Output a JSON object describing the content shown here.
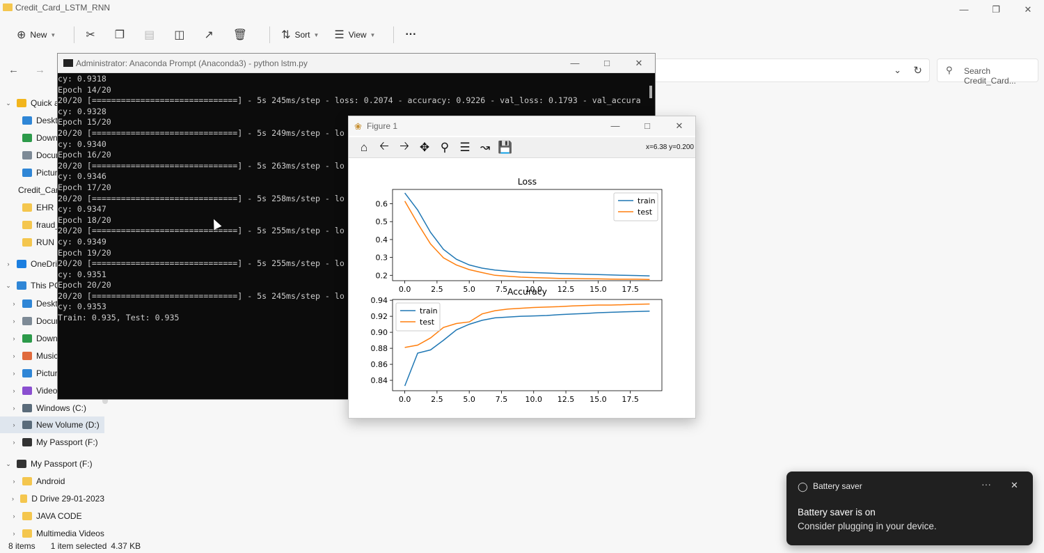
{
  "explorer": {
    "window_title": "Credit_Card_LSTM_RNN",
    "toolbar": {
      "new_label": "New",
      "sort_label": "Sort",
      "view_label": "View",
      "more_label": "···"
    },
    "search_placeholder": "Search Credit_Card...",
    "sidebar": [
      {
        "label": "Quick access",
        "level": 0,
        "icon": "star-icon",
        "color": "#f2b51d"
      },
      {
        "label": "Desktop",
        "level": 1,
        "icon": "desktop-icon",
        "color": "#2f86d6"
      },
      {
        "label": "Downloads",
        "level": 1,
        "icon": "download-icon",
        "color": "#2c9a4a"
      },
      {
        "label": "Documents",
        "level": 1,
        "icon": "document-icon",
        "color": "#7d8a96"
      },
      {
        "label": "Pictures",
        "level": 1,
        "icon": "pictures-icon",
        "color": "#2f86d6"
      },
      {
        "label": "Credit_Card_LSTM_RNN",
        "level": 1,
        "icon": "folder-icon",
        "color": "#f4c64e"
      },
      {
        "label": "EHR",
        "level": 1,
        "icon": "folder-icon",
        "color": "#f4c64e"
      },
      {
        "label": "fraud_detection",
        "level": 1,
        "icon": "folder-icon",
        "color": "#f4c64e"
      },
      {
        "label": "RUN",
        "level": 1,
        "icon": "folder-icon",
        "color": "#f4c64e"
      },
      {
        "label": "OneDrive",
        "level": 0,
        "icon": "cloud-icon",
        "color": "#1c7fe0"
      },
      {
        "label": "This PC",
        "level": 0,
        "icon": "computer-icon",
        "color": "#2f86d6"
      },
      {
        "label": "Desktop",
        "level": 1,
        "icon": "desktop-icon",
        "color": "#2f86d6"
      },
      {
        "label": "Documents",
        "level": 1,
        "icon": "document-icon",
        "color": "#7d8a96"
      },
      {
        "label": "Downloads",
        "level": 1,
        "icon": "download-icon",
        "color": "#2c9a4a"
      },
      {
        "label": "Music",
        "level": 1,
        "icon": "music-icon",
        "color": "#e06a3c"
      },
      {
        "label": "Pictures",
        "level": 1,
        "icon": "pictures-icon",
        "color": "#2f86d6"
      },
      {
        "label": "Videos",
        "level": 1,
        "icon": "videos-icon",
        "color": "#8a4fd0"
      },
      {
        "label": "Windows (C:)",
        "level": 1,
        "icon": "drive-icon",
        "color": "#5a6b7a"
      },
      {
        "label": "New Volume (D:)",
        "level": 1,
        "icon": "drive-icon",
        "color": "#5a6b7a"
      },
      {
        "label": "My Passport (F:)",
        "level": 1,
        "icon": "drive-icon",
        "color": "#333333"
      },
      {
        "label": "My Passport (F:)",
        "level": 0,
        "icon": "drive-icon",
        "color": "#333333"
      },
      {
        "label": "Android",
        "level": 1,
        "icon": "folder-icon",
        "color": "#f4c64e"
      },
      {
        "label": "D Drive 29-01-2023",
        "level": 1,
        "icon": "folder-icon",
        "color": "#f4c64e"
      },
      {
        "label": "JAVA CODE",
        "level": 1,
        "icon": "folder-icon",
        "color": "#f4c64e"
      },
      {
        "label": "Multimedia Videos",
        "level": 1,
        "icon": "folder-icon",
        "color": "#f4c64e"
      }
    ],
    "status": {
      "items": "8 items",
      "selected": "1 item selected",
      "size": "4.37 KB"
    }
  },
  "terminal": {
    "title": "Administrator: Anaconda Prompt (Anaconda3) - python  lstm.py",
    "lines": [
      "cy: 0.9318",
      "Epoch 14/20",
      "20/20 [==============================] - 5s 245ms/step - loss: 0.2074 - accuracy: 0.9226 - val_loss: 0.1793 - val_accura",
      "cy: 0.9328",
      "Epoch 15/20",
      "20/20 [==============================] - 5s 249ms/step - lo",
      "cy: 0.9340",
      "Epoch 16/20",
      "20/20 [==============================] - 5s 263ms/step - lo",
      "cy: 0.9346",
      "Epoch 17/20",
      "20/20 [==============================] - 5s 258ms/step - lo",
      "cy: 0.9347",
      "Epoch 18/20",
      "20/20 [==============================] - 5s 255ms/step - lo",
      "cy: 0.9349",
      "Epoch 19/20",
      "20/20 [==============================] - 5s 255ms/step - lo",
      "cy: 0.9351",
      "Epoch 20/20",
      "20/20 [==============================] - 5s 245ms/step - lo",
      "cy: 0.9353",
      "Train: 0.935, Test: 0.935"
    ]
  },
  "figure": {
    "title": "Figure 1",
    "coords": "x=6.38 y=0.200"
  },
  "chart_data": [
    {
      "type": "line",
      "title": "Loss",
      "xlabel": "",
      "ylabel": "",
      "x": [
        0,
        1,
        2,
        3,
        4,
        5,
        6,
        7,
        8,
        9,
        10,
        11,
        12,
        13,
        14,
        15,
        16,
        17,
        18,
        19
      ],
      "xlim": [
        -0.95,
        19.95
      ],
      "ylim": [
        0.17,
        0.68
      ],
      "xticks": [
        0.0,
        2.5,
        5.0,
        7.5,
        10.0,
        12.5,
        15.0,
        17.5
      ],
      "xtick_labels": [
        "0.0",
        "2.5",
        "5.0",
        "7.5",
        "10.0",
        "12.5",
        "15.0",
        "17.5"
      ],
      "yticks": [
        0.2,
        0.3,
        0.4,
        0.5,
        0.6
      ],
      "ytick_labels": [
        "0.2",
        "0.3",
        "0.4",
        "0.5",
        "0.6"
      ],
      "legend": "top-right",
      "series": [
        {
          "name": "train",
          "color": "#1f77b4",
          "values": [
            0.66,
            0.565,
            0.44,
            0.345,
            0.29,
            0.258,
            0.24,
            0.229,
            0.223,
            0.218,
            0.215,
            0.213,
            0.21,
            0.208,
            0.206,
            0.204,
            0.202,
            0.2,
            0.199,
            0.197
          ]
        },
        {
          "name": "test",
          "color": "#ff7f0e",
          "values": [
            0.615,
            0.49,
            0.375,
            0.298,
            0.258,
            0.232,
            0.215,
            0.2,
            0.195,
            0.19,
            0.187,
            0.185,
            0.183,
            0.182,
            0.181,
            0.18,
            0.179,
            0.178,
            0.178,
            0.177
          ]
        }
      ]
    },
    {
      "type": "line",
      "title": "Accuracy",
      "xlabel": "",
      "ylabel": "",
      "x": [
        0,
        1,
        2,
        3,
        4,
        5,
        6,
        7,
        8,
        9,
        10,
        11,
        12,
        13,
        14,
        15,
        16,
        17,
        18,
        19
      ],
      "xlim": [
        -0.95,
        19.95
      ],
      "ylim": [
        0.827,
        0.941
      ],
      "xticks": [
        0.0,
        2.5,
        5.0,
        7.5,
        10.0,
        12.5,
        15.0,
        17.5
      ],
      "xtick_labels": [
        "0.0",
        "2.5",
        "5.0",
        "7.5",
        "10.0",
        "12.5",
        "15.0",
        "17.5"
      ],
      "yticks": [
        0.84,
        0.86,
        0.88,
        0.9,
        0.92,
        0.94
      ],
      "ytick_labels": [
        "0.84",
        "0.86",
        "0.88",
        "0.90",
        "0.92",
        "0.94"
      ],
      "legend": "top-left",
      "series": [
        {
          "name": "train",
          "color": "#1f77b4",
          "values": [
            0.833,
            0.874,
            0.878,
            0.89,
            0.903,
            0.91,
            0.915,
            0.918,
            0.919,
            0.92,
            0.9205,
            0.921,
            0.922,
            0.9228,
            0.9235,
            0.9245,
            0.925,
            0.9255,
            0.926,
            0.9265
          ]
        },
        {
          "name": "test",
          "color": "#ff7f0e",
          "values": [
            0.881,
            0.884,
            0.893,
            0.906,
            0.911,
            0.913,
            0.923,
            0.927,
            0.929,
            0.93,
            0.931,
            0.9315,
            0.932,
            0.933,
            0.9335,
            0.934,
            0.934,
            0.9345,
            0.935,
            0.9353
          ]
        }
      ]
    }
  ],
  "toast": {
    "app": "Battery saver",
    "heading": "Battery saver is on",
    "body": "Consider plugging in your device.",
    "more": "···",
    "close": "✕"
  }
}
